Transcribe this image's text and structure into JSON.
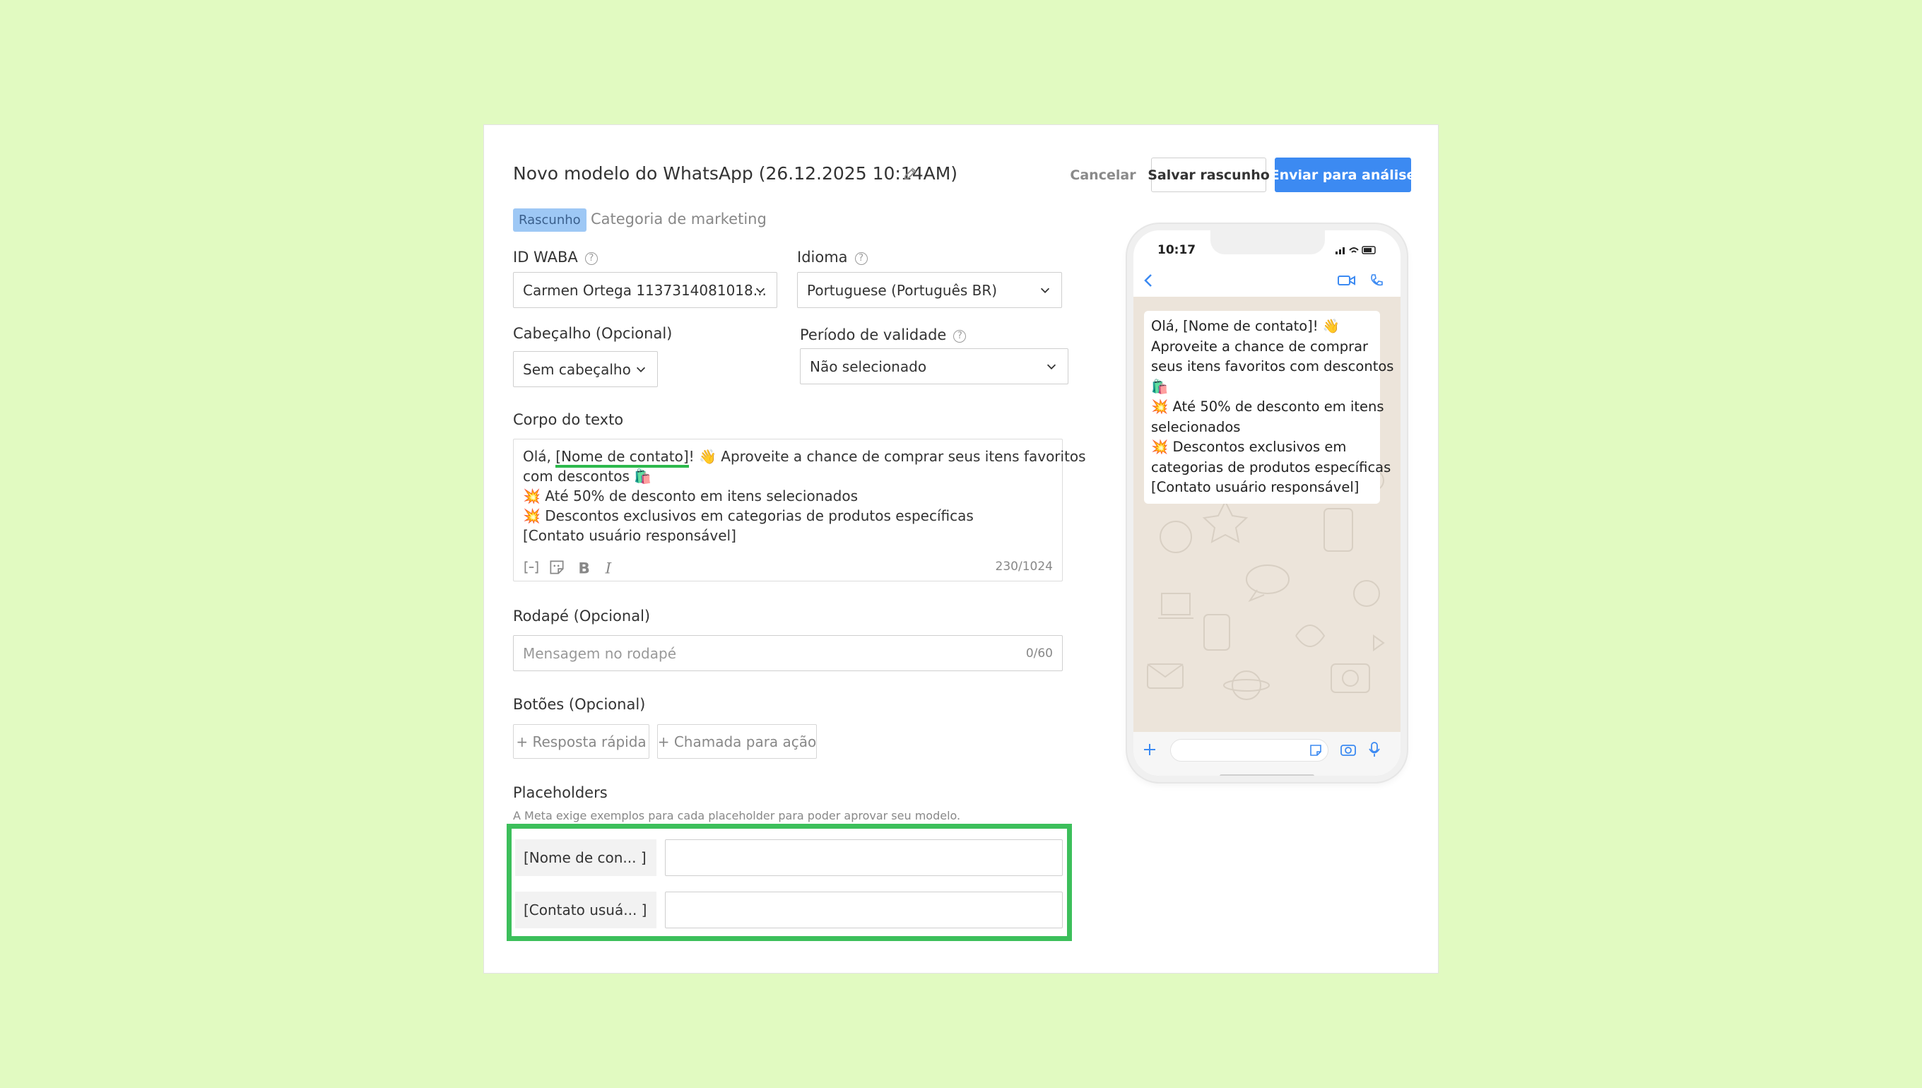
{
  "header": {
    "title": "Novo modelo do WhatsApp (26.12.2025 10:14AM)",
    "cancel_label": "Cancelar",
    "save_draft_label": "Salvar rascunho",
    "submit_label": "Enviar para análise"
  },
  "status": {
    "badge": "Rascunho",
    "category": "Categoria de marketing"
  },
  "fields": {
    "waba_label": "ID WABA",
    "waba_value": "Carmen Ortega 1137314081018...",
    "language_label": "Idioma",
    "language_value": "Portuguese (Português BR)",
    "header_label": "Cabeçalho (Opcional)",
    "header_value": "Sem cabeçalho",
    "validity_label": "Período de validade",
    "validity_value": "Não selecionado"
  },
  "body": {
    "label": "Corpo do texto",
    "line1_pre": "Olá, ",
    "line1_var": "[Nome de contato]",
    "line1_post": "! 👋 Aproveite a chance de comprar seus itens favoritos",
    "line2": "com descontos 🛍️",
    "line3": "💥 Até 50% de desconto em itens selecionados",
    "line4": "💥 Descontos exclusivos em categorias de produtos específicas",
    "line5_var": "[Contato usuário responsável]",
    "counter": "230/1024"
  },
  "footer": {
    "label": "Rodapé (Opcional)",
    "placeholder": "Mensagem no rodapé",
    "counter": "0/60"
  },
  "buttons": {
    "label": "Botões (Opcional)",
    "quick_reply": "+ Resposta rápida",
    "call_to_action": "+ Chamada para ação"
  },
  "placeholders": {
    "label": "Placeholders",
    "hint": "A Meta exige exemplos para cada placeholder para poder aprovar seu modelo.",
    "items": [
      {
        "name": "[Nome de con... ]",
        "value": ""
      },
      {
        "name": "[Contato usuá... ]",
        "value": ""
      }
    ]
  },
  "preview": {
    "time": "10:17",
    "lines": [
      "Olá, [Nome de contato]! 👋",
      "Aproveite a chance de comprar",
      "seus itens favoritos com descontos",
      "🛍️",
      "💥 Até 50% de desconto em itens",
      "selecionados",
      "💥 Descontos exclusivos em",
      "categorias de produtos específicas",
      "[Contato usuário responsável]"
    ]
  },
  "colors": {
    "page_background": "#e1fac1",
    "primary": "#3c8af2",
    "highlight": "#3cbf5b",
    "badge": "#9ec8f5"
  },
  "icons": [
    "pencil-icon",
    "help-icon",
    "chevron-down-icon",
    "variable-icon",
    "sticker-icon",
    "bold-icon",
    "italic-icon",
    "back-icon",
    "video-icon",
    "phone-icon",
    "plus-icon",
    "camera-icon",
    "mic-icon"
  ]
}
